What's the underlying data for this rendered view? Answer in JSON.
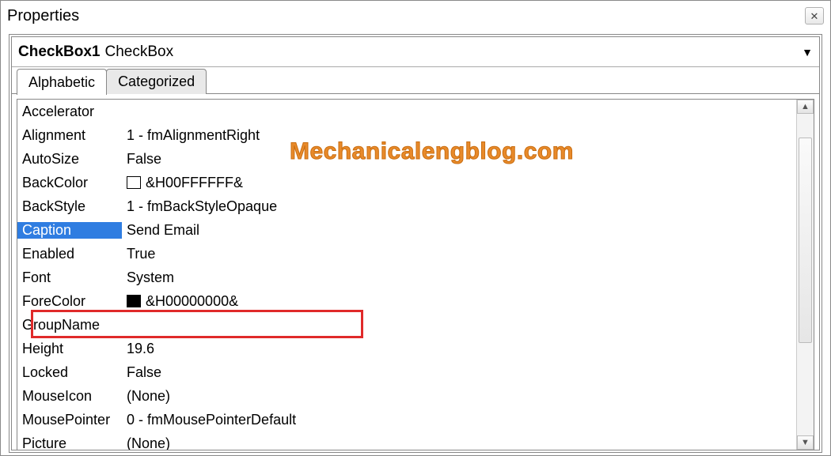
{
  "panel": {
    "title": "Properties"
  },
  "object": {
    "name": "CheckBox1",
    "type": "CheckBox"
  },
  "tabs": {
    "alphabetic": "Alphabetic",
    "categorized": "Categorized",
    "active": "alphabetic"
  },
  "watermark": "Mechanicalengblog.com",
  "highlight_index": 5,
  "properties": [
    {
      "name": "Accelerator",
      "value": ""
    },
    {
      "name": "Alignment",
      "value": "1 - fmAlignmentRight"
    },
    {
      "name": "AutoSize",
      "value": "False"
    },
    {
      "name": "BackColor",
      "value": "&H00FFFFFF&",
      "swatch": "white"
    },
    {
      "name": "BackStyle",
      "value": "1 - fmBackStyleOpaque"
    },
    {
      "name": "Caption",
      "value": "Send Email"
    },
    {
      "name": "Enabled",
      "value": "True"
    },
    {
      "name": "Font",
      "value": "System"
    },
    {
      "name": "ForeColor",
      "value": "&H00000000&",
      "swatch": "black"
    },
    {
      "name": "GroupName",
      "value": ""
    },
    {
      "name": "Height",
      "value": "19.6"
    },
    {
      "name": "Locked",
      "value": "False"
    },
    {
      "name": "MouseIcon",
      "value": "(None)"
    },
    {
      "name": "MousePointer",
      "value": "0 - fmMousePointerDefault"
    },
    {
      "name": "Picture",
      "value": "(None)"
    }
  ]
}
